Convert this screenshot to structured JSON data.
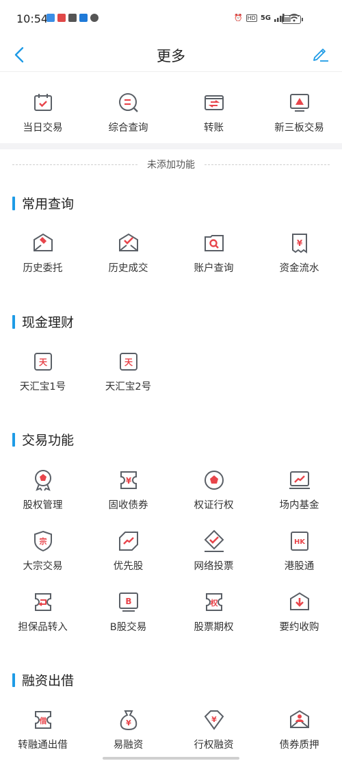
{
  "status": {
    "time": "10:54",
    "net": "5G"
  },
  "nav": {
    "title": "更多"
  },
  "added": [
    {
      "label": "当日交易",
      "icon": "calendar-check-icon"
    },
    {
      "label": "综合查询",
      "icon": "search-list-icon"
    },
    {
      "label": "转账",
      "icon": "transfer-icon"
    },
    {
      "label": "新三板交易",
      "icon": "monitor-chart-icon"
    }
  ],
  "divider": {
    "text": "未添加功能"
  },
  "sections": {
    "common": {
      "title": "常用查询",
      "items": [
        {
          "label": "历史委托",
          "icon": "history-order-icon"
        },
        {
          "label": "历史成交",
          "icon": "history-deal-icon"
        },
        {
          "label": "账户查询",
          "icon": "account-search-icon"
        },
        {
          "label": "资金流水",
          "icon": "cash-flow-icon"
        }
      ]
    },
    "cash": {
      "title": "现金理财",
      "items": [
        {
          "label": "天汇宝1号",
          "icon": "tianhuibao-icon"
        },
        {
          "label": "天汇宝2号",
          "icon": "tianhuibao-icon"
        }
      ]
    },
    "trade": {
      "title": "交易功能",
      "items": [
        {
          "label": "股权管理",
          "icon": "equity-badge-icon"
        },
        {
          "label": "固收债券",
          "icon": "fixed-income-icon"
        },
        {
          "label": "权证行权",
          "icon": "warrant-icon"
        },
        {
          "label": "场内基金",
          "icon": "fund-chart-icon"
        },
        {
          "label": "大宗交易",
          "icon": "block-trade-icon"
        },
        {
          "label": "优先股",
          "icon": "preferred-stock-icon"
        },
        {
          "label": "网络投票",
          "icon": "vote-icon"
        },
        {
          "label": "港股通",
          "icon": "hk-connect-icon"
        },
        {
          "label": "担保品转入",
          "icon": "collateral-icon"
        },
        {
          "label": "B股交易",
          "icon": "b-share-icon"
        },
        {
          "label": "股票期权",
          "icon": "stock-option-icon"
        },
        {
          "label": "要约收购",
          "icon": "tender-offer-icon"
        }
      ]
    },
    "lending": {
      "title": "融资出借",
      "items": [
        {
          "label": "转融通出借",
          "icon": "refinance-lend-icon"
        },
        {
          "label": "易融资",
          "icon": "money-bag-icon"
        },
        {
          "label": "行权融资",
          "icon": "exercise-finance-icon"
        },
        {
          "label": "债券质押",
          "icon": "bond-pledge-icon"
        }
      ]
    }
  },
  "colors": {
    "accent": "#1e9be6",
    "icon_red": "#e8454b",
    "icon_gray": "#5a5f66"
  }
}
